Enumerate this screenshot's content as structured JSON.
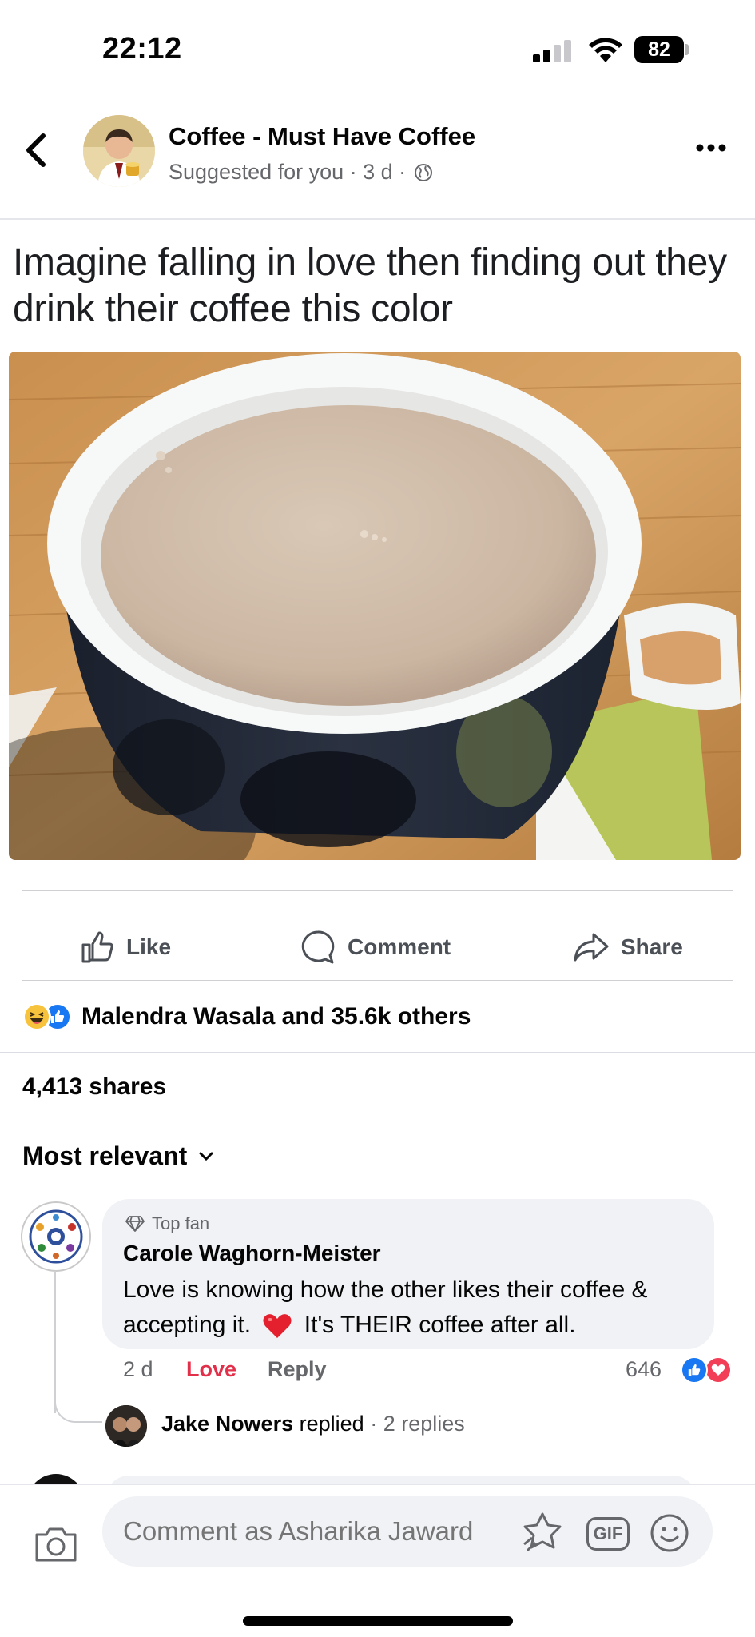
{
  "status_bar": {
    "time": "22:12",
    "battery": "82"
  },
  "post": {
    "page_name": "Coffee - Must Have Coffee",
    "meta": "Suggested for you · 3 d ·",
    "caption": "Imagine falling in love then finding out they drink their coffee this color"
  },
  "actions": {
    "like": "Like",
    "comment": "Comment",
    "share": "Share"
  },
  "reactions": {
    "summary": "Malendra Wasala and 35.6k others",
    "shares": "4,413 shares"
  },
  "comments": {
    "sort_label": "Most relevant",
    "top_comment": {
      "badge": "Top fan",
      "author": "Carole Waghorn-Meister",
      "text_before_emoji": "Love is knowing how the other likes their coffee & accepting it.",
      "text_after_emoji": "It's THEIR coffee after all.",
      "time": "2 d",
      "love_label": "Love",
      "reply_label": "Reply",
      "reaction_count": "646"
    },
    "reply_summary": {
      "author": "Jake Nowers",
      "action": "replied",
      "count": "· 2 replies"
    }
  },
  "composer": {
    "placeholder": "Comment as Asharika Jaward",
    "gif_label": "GIF"
  },
  "colors": {
    "primary_blue": "#1877f2",
    "love_red": "#e3304a",
    "muted_text": "#65676b",
    "bubble_bg": "#f0f2f5"
  },
  "icons": [
    "back-icon",
    "more-icon",
    "globe-icon",
    "like-icon",
    "comment-icon",
    "share-icon",
    "chevron-down-icon",
    "diamond-icon",
    "heart-emoji-icon",
    "camera-icon",
    "avatar-sticker-icon",
    "gif-icon",
    "emoji-icon"
  ]
}
